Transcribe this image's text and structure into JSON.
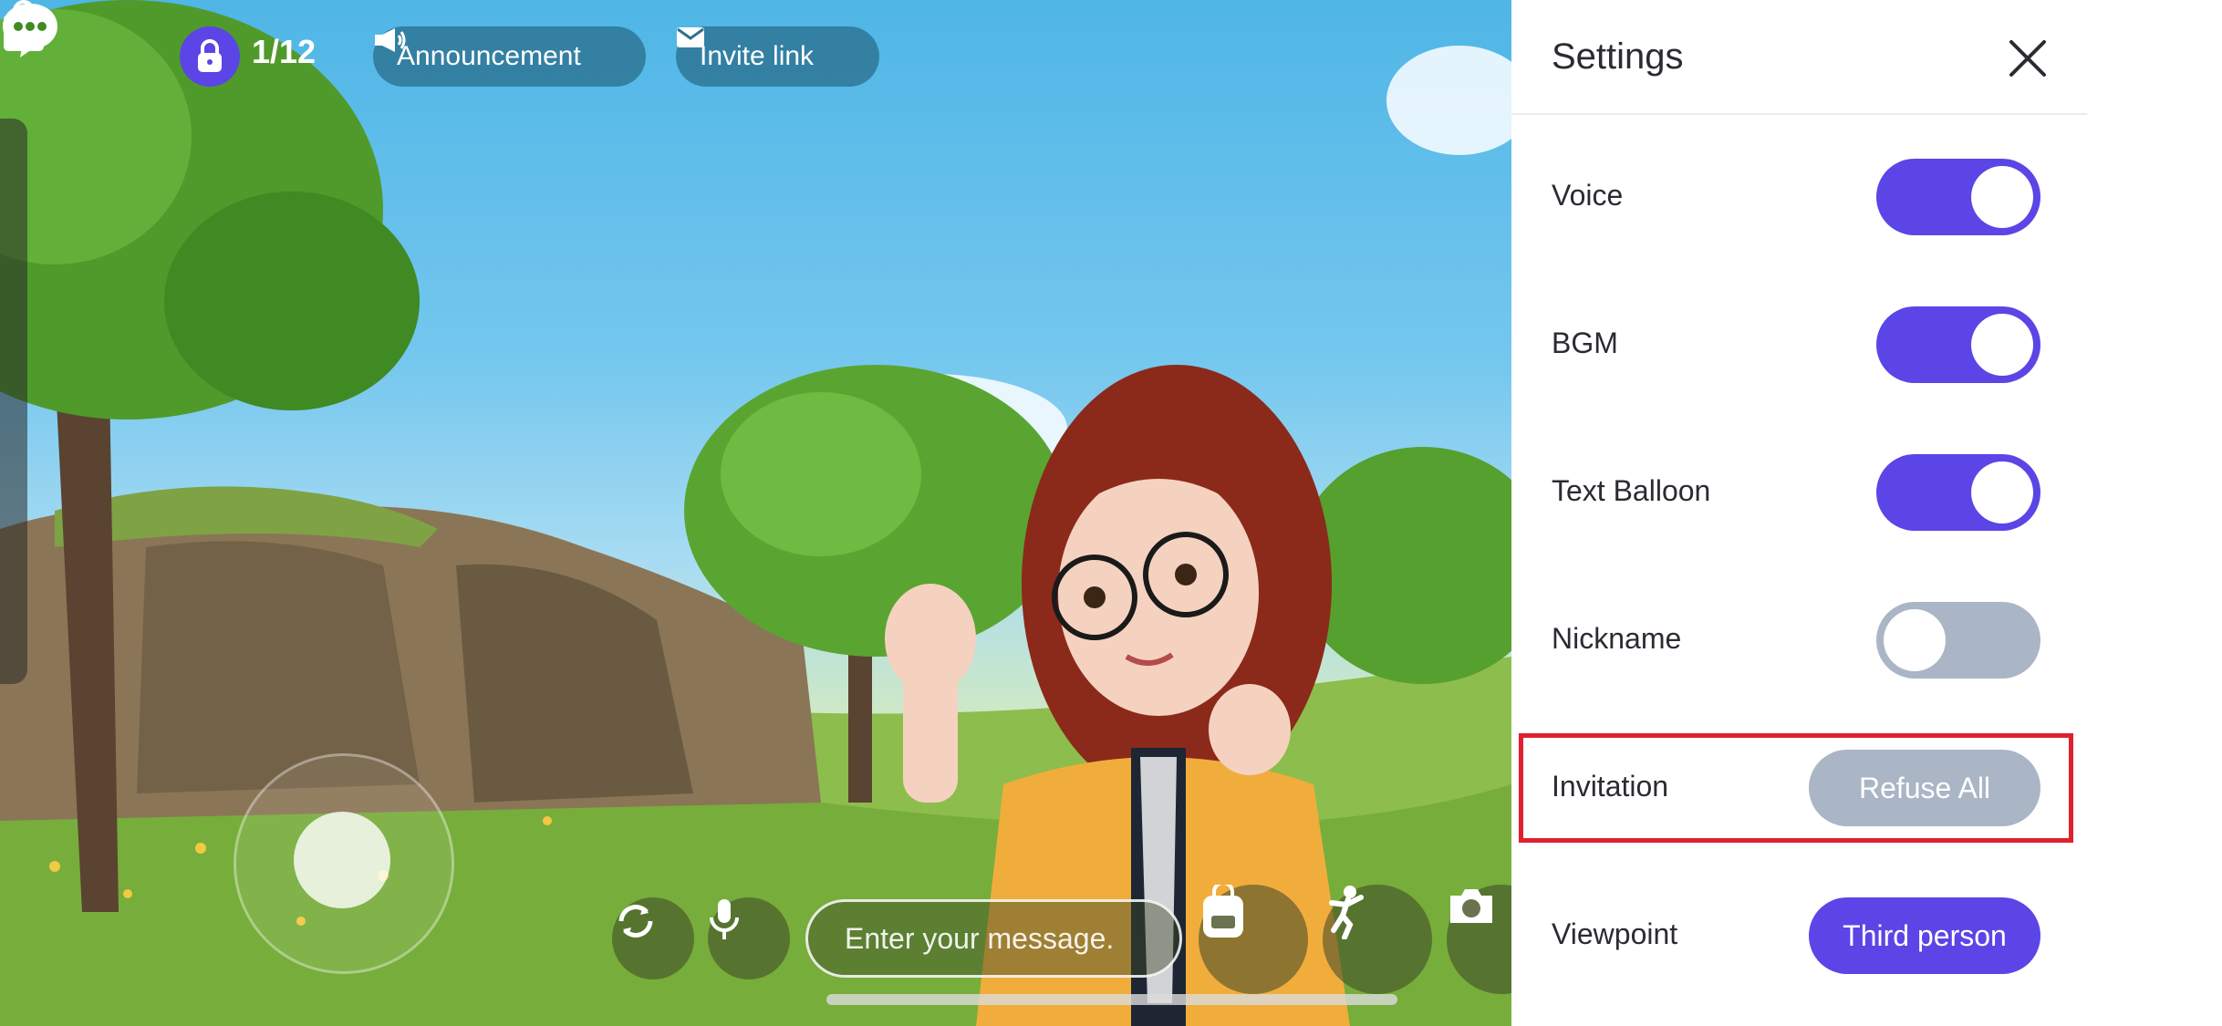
{
  "hud": {
    "room_count": "1/12",
    "announcement_label": "Announcement",
    "invite_link_label": "Invite link",
    "message_placeholder": "Enter your message."
  },
  "settings": {
    "title": "Settings",
    "rows": [
      {
        "label": "Voice",
        "control": "toggle",
        "on": true
      },
      {
        "label": "BGM",
        "control": "toggle",
        "on": true
      },
      {
        "label": "Text Balloon",
        "control": "toggle",
        "on": true
      },
      {
        "label": "Nickname",
        "control": "toggle",
        "on": false
      },
      {
        "label": "Invitation",
        "control": "button",
        "value": "Refuse All"
      },
      {
        "label": "Viewpoint",
        "control": "button",
        "value": "Third person"
      }
    ]
  },
  "colors": {
    "accent": "#5b45e6",
    "toggle_off": "#aab6c5",
    "highlight": "#e0202e"
  }
}
